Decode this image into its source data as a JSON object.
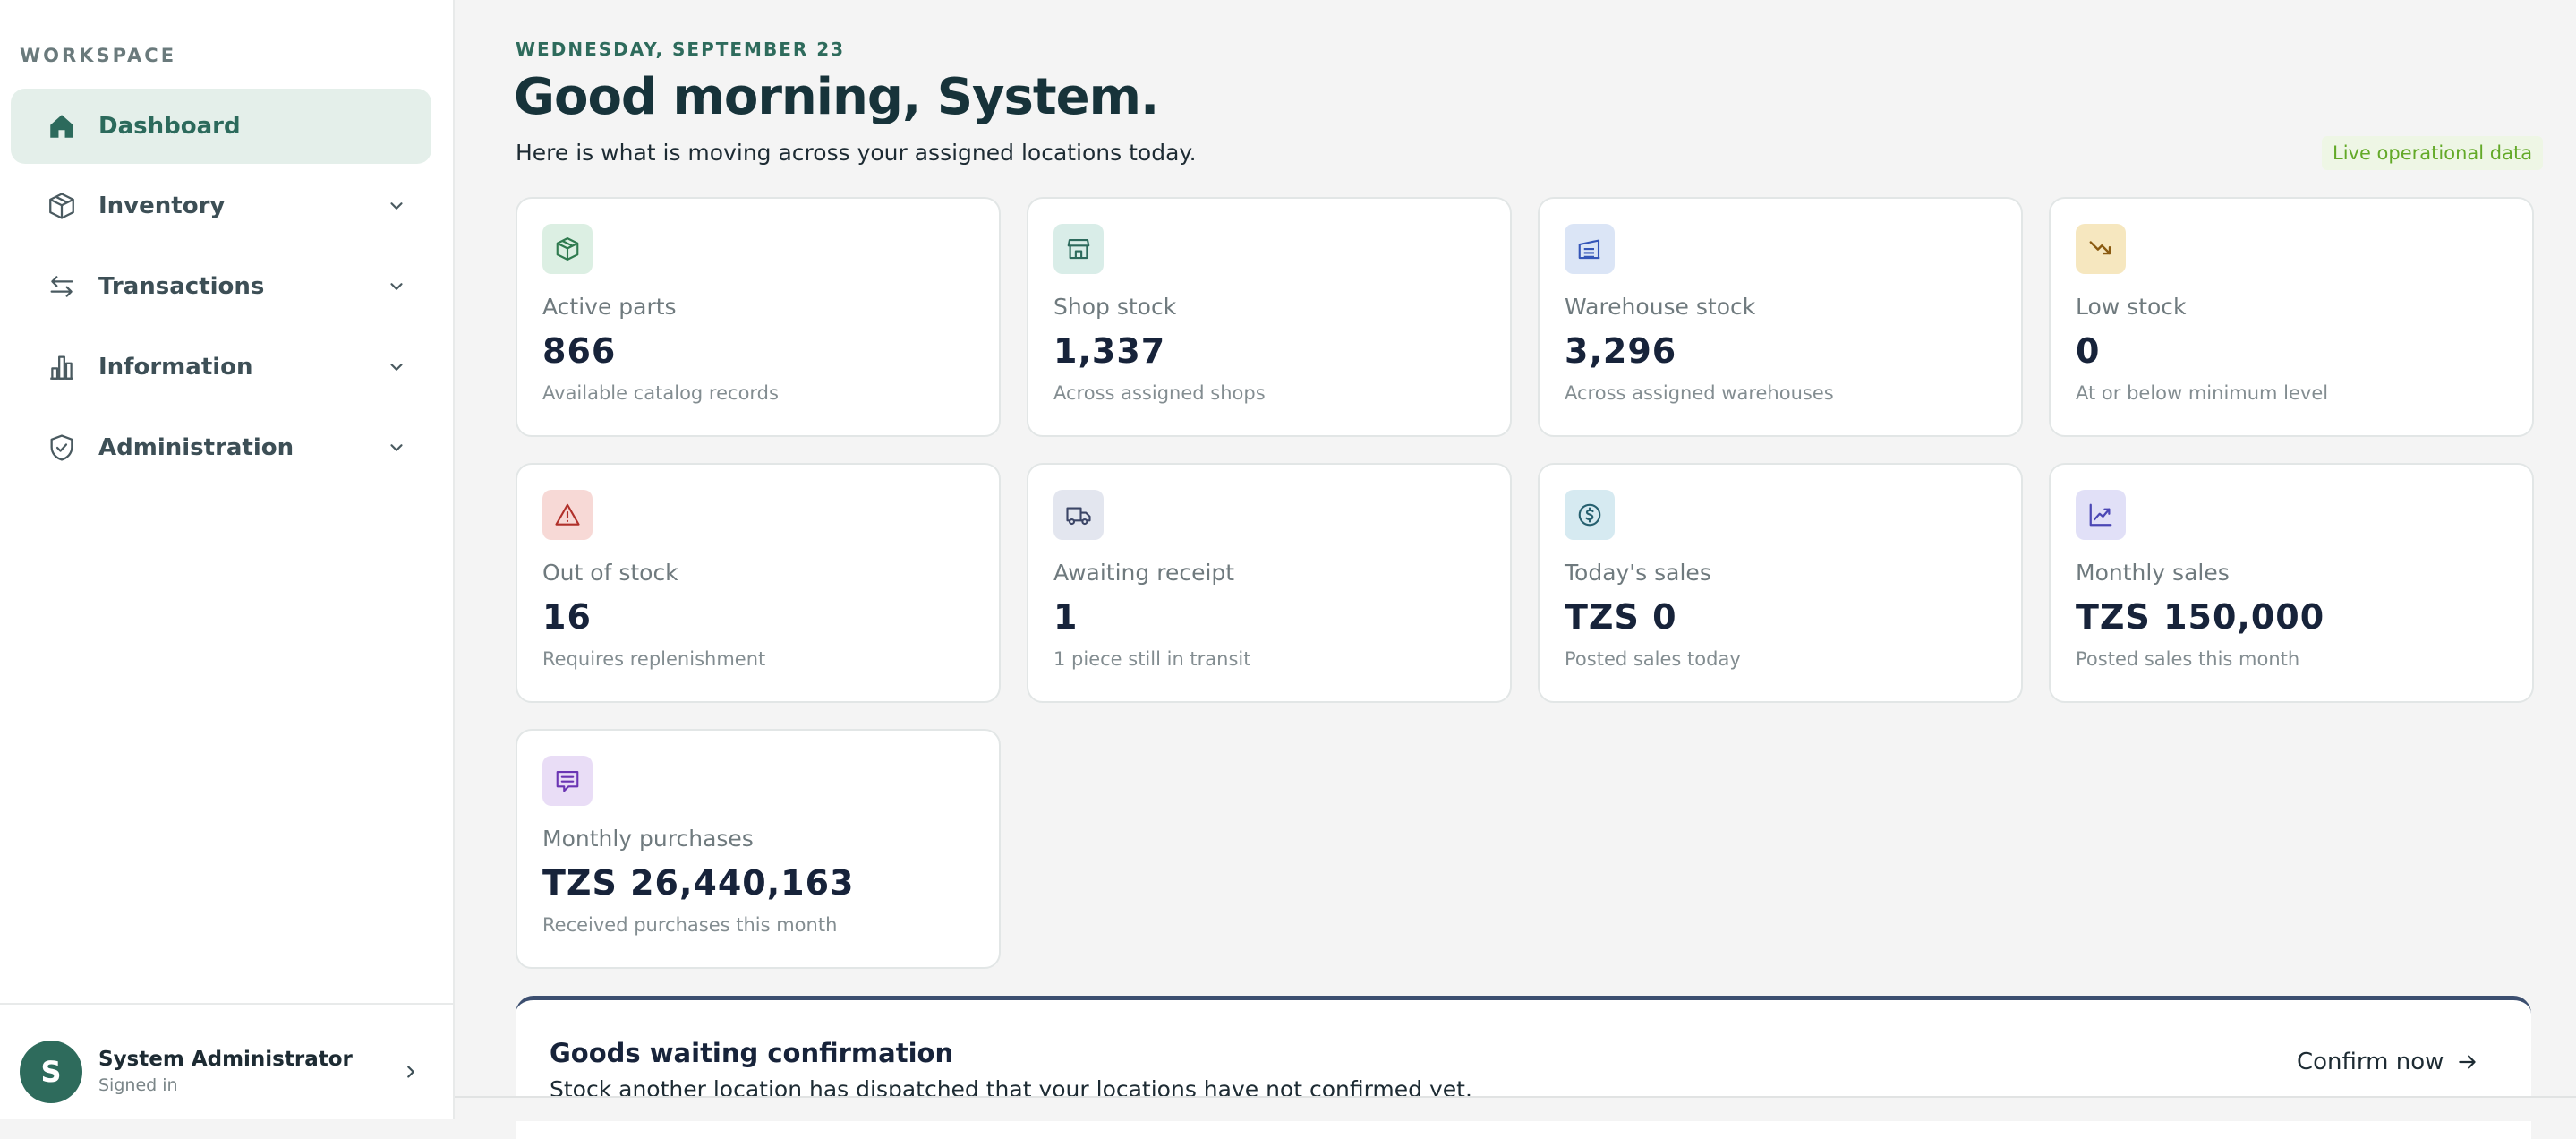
{
  "sidebar": {
    "section_label": "WORKSPACE",
    "items": [
      {
        "label": "Dashboard",
        "icon": "home-icon"
      },
      {
        "label": "Inventory",
        "icon": "package-icon"
      },
      {
        "label": "Transactions",
        "icon": "swap-arrows-icon"
      },
      {
        "label": "Information",
        "icon": "bar-chart-icon"
      },
      {
        "label": "Administration",
        "icon": "shield-check-icon"
      }
    ],
    "user": {
      "initial": "S",
      "name": "System Administrator",
      "status": "Signed in"
    }
  },
  "header": {
    "date": "WEDNESDAY, SEPTEMBER 23",
    "greeting": "Good morning, System.",
    "subtitle": "Here is what is moving across your assigned locations today.",
    "badge": "Live operational data"
  },
  "cards": [
    {
      "label": "Active parts",
      "value": "866",
      "desc": "Available catalog records",
      "icon": "box-icon",
      "icon_bg": "#dcefe3",
      "icon_color": "#2f7a4f"
    },
    {
      "label": "Shop stock",
      "value": "1,337",
      "desc": "Across assigned shops",
      "icon": "store-icon",
      "icon_bg": "#d9ede8",
      "icon_color": "#2c6a5c"
    },
    {
      "label": "Warehouse stock",
      "value": "3,296",
      "desc": "Across assigned warehouses",
      "icon": "warehouse-icon",
      "icon_bg": "#dbe5f6",
      "icon_color": "#3556b8"
    },
    {
      "label": "Low stock",
      "value": "0",
      "desc": "At or below minimum level",
      "icon": "trend-down-icon",
      "icon_bg": "#f6e7bf",
      "icon_color": "#8a5a10"
    },
    {
      "label": "Out of stock",
      "value": "16",
      "desc": "Requires replenishment",
      "icon": "warning-icon",
      "icon_bg": "#f7d9d6",
      "icon_color": "#b0302a"
    },
    {
      "label": "Awaiting receipt",
      "value": "1",
      "desc": "1 piece still in transit",
      "icon": "truck-icon",
      "icon_bg": "#e3e6ef",
      "icon_color": "#3b4566"
    },
    {
      "label": "Today's sales",
      "value": "TZS 0",
      "desc": "Posted sales today",
      "icon": "dollar-circle-icon",
      "icon_bg": "#d6eaf1",
      "icon_color": "#26606f"
    },
    {
      "label": "Monthly sales",
      "value": "TZS 150,000",
      "desc": "Posted sales this month",
      "icon": "trend-up-icon",
      "icon_bg": "#e1e0f7",
      "icon_color": "#4b47b5"
    },
    {
      "label": "Monthly purchases",
      "value": "TZS 26,440,163",
      "desc": "Received purchases this month",
      "icon": "receipt-icon",
      "icon_bg": "#e9ddf6",
      "icon_color": "#6a35b3"
    }
  ],
  "banner": {
    "title": "Goods waiting confirmation",
    "text": "Stock another location has dispatched that your locations have not confirmed yet.",
    "action": "Confirm now"
  }
}
